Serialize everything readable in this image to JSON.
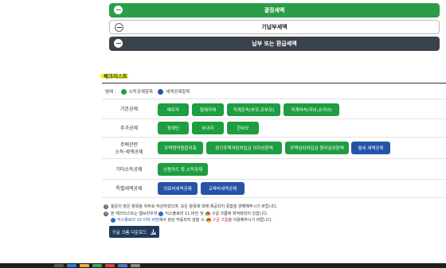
{
  "results": {
    "determined_tax": "결정세액",
    "prepaid_tax": "기납부세액",
    "final_tax": "납부 또는 환급세액"
  },
  "checklist": {
    "title": "체크리스트",
    "legend_label": "범례 :",
    "legend_income": "소득공제항목",
    "legend_tax": "세액공제항목"
  },
  "rows": {
    "basic": {
      "label": "기본공제",
      "items": [
        "배우자",
        "형제자매",
        "직계존속(부모,조부모)",
        "직계비속(자녀,손자녀)"
      ]
    },
    "additional": {
      "label": "추가공제",
      "items": [
        "장애인",
        "부녀자",
        "한부모"
      ]
    },
    "housing": {
      "label_line1": "주택관련",
      "label_line2": "소득·세액공제",
      "items": [
        "주택청약종합저축",
        "장기주택저당차입금 이자상환액",
        "주택임차차입금 원리금상환액",
        "월세 세액공제"
      ]
    },
    "other_income": {
      "label": "기타소득공제",
      "items": [
        "신용카드 등 소득공제"
      ]
    },
    "special_tax": {
      "label": "특별세액공제",
      "items": [
        "의료비세액공제",
        "교육비세액공제"
      ]
    }
  },
  "notes": {
    "note1": "질문이 많은 항목을 위주로 작성하였으며, 모든 항목에 대해 제공되지 못함을 양해해주시기 바랍니다.",
    "note2_prefix": "본 체크리스트는 웹브라우저",
    "note2_ie": "익스플로러 11 버전",
    "note2_mid": "및",
    "note2_chrome": "구글 크롬",
    "note2_suffix": "에 최적화되어 있습니다.",
    "note3_ie": "익스플로러 10 이하 버전",
    "note3_mid": "에서 정상 작동되지 않을 시",
    "note3_chrome": "구글 크롬",
    "note3_suffix": "을 이용해주시기 바랍니다."
  },
  "download": {
    "label": "구글 크롬 다운로드"
  },
  "colors": {
    "income_green": "#1e9d41",
    "tax_blue": "#2553a8",
    "result_green": "#2a9d48",
    "result_dark": "#3a424b",
    "highlight": "#f4f320"
  }
}
